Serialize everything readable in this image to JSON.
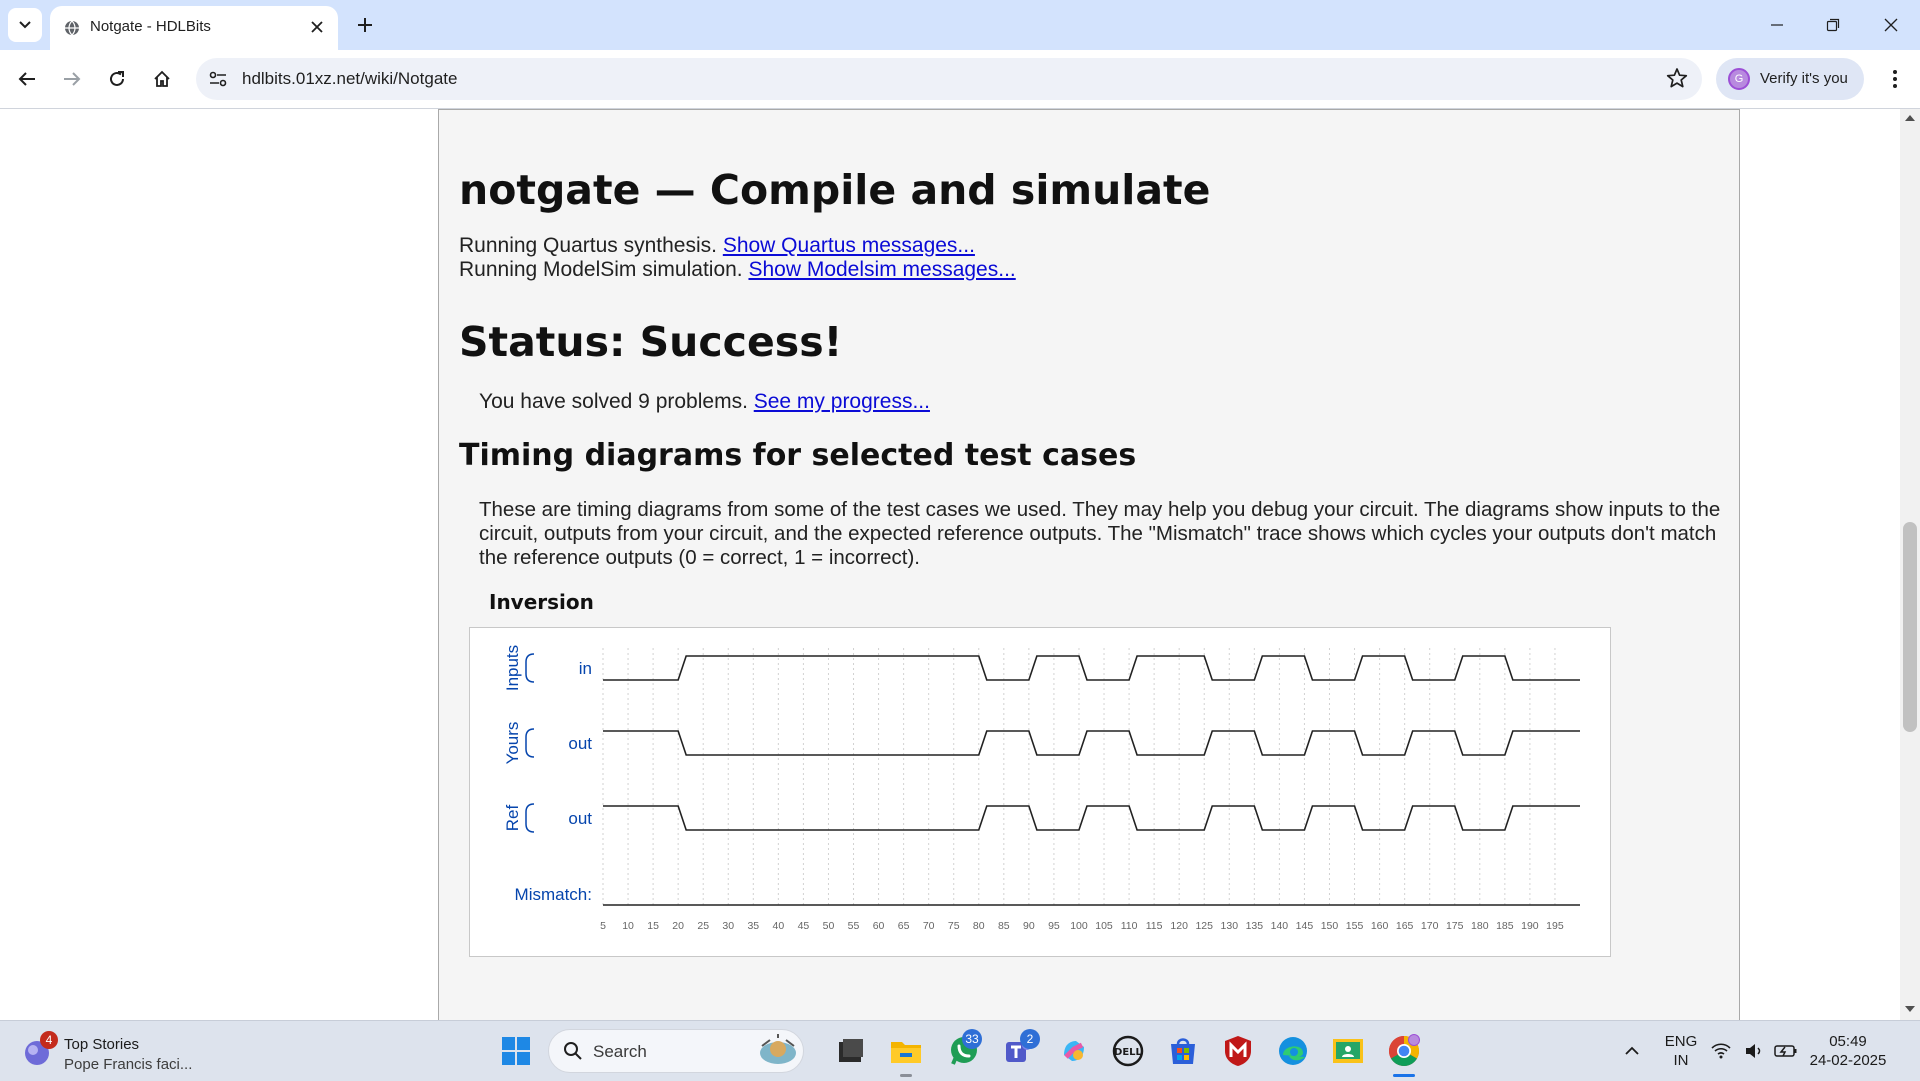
{
  "browser": {
    "tab_title": "Notgate - HDLBits",
    "url": "hdlbits.01xz.net/wiki/Notgate",
    "profile_button": "Verify it's you",
    "profile_initial": "G"
  },
  "page": {
    "heading": "notgate — Compile and simulate",
    "quartus_text": "Running Quartus synthesis. ",
    "quartus_link": "Show Quartus messages...",
    "modelsim_text": "Running ModelSim simulation. ",
    "modelsim_link": "Show Modelsim messages...",
    "status": "Status: Success!",
    "solved_text": "You have solved 9 problems. ",
    "progress_link": "See my progress...",
    "timing_heading": "Timing diagrams for selected test cases",
    "timing_description": "These are timing diagrams from some of the test cases we used. They may help you debug your circuit. The diagrams show inputs to the circuit, outputs from your circuit, and the expected reference outputs. The \"Mismatch\" trace shows which cycles your outputs don't match the reference outputs (0 = correct, 1 = incorrect).",
    "testcase_title": "Inversion"
  },
  "timing": {
    "groups": [
      {
        "name": "Inputs",
        "signal": "in"
      },
      {
        "name": "Yours",
        "signal": "out"
      },
      {
        "name": "Ref",
        "signal": "out"
      }
    ],
    "mismatch_label": "Mismatch:",
    "in_edges": [
      20,
      80,
      90,
      100,
      110,
      125,
      135,
      145,
      155,
      165,
      175,
      185
    ],
    "in_initial": 0,
    "out_initial": 1,
    "time_ticks": [
      5,
      10,
      15,
      20,
      25,
      30,
      35,
      40,
      45,
      50,
      55,
      60,
      65,
      70,
      75,
      80,
      85,
      90,
      95,
      100,
      105,
      110,
      115,
      120,
      125,
      130,
      135,
      140,
      145,
      150,
      155,
      160,
      165,
      170,
      175,
      180,
      185,
      190,
      195
    ],
    "time_start": 5,
    "time_end": 200,
    "accent_color": "#0645ad"
  },
  "taskbar": {
    "news_title": "Top Stories",
    "news_subtitle": "Pope Francis faci...",
    "news_badge": "4",
    "search_label": "Search",
    "whatsapp_badge": "33",
    "teams_badge": "2",
    "language_line1": "ENG",
    "language_line2": "IN",
    "time": "05:49",
    "date": "24-02-2025"
  }
}
